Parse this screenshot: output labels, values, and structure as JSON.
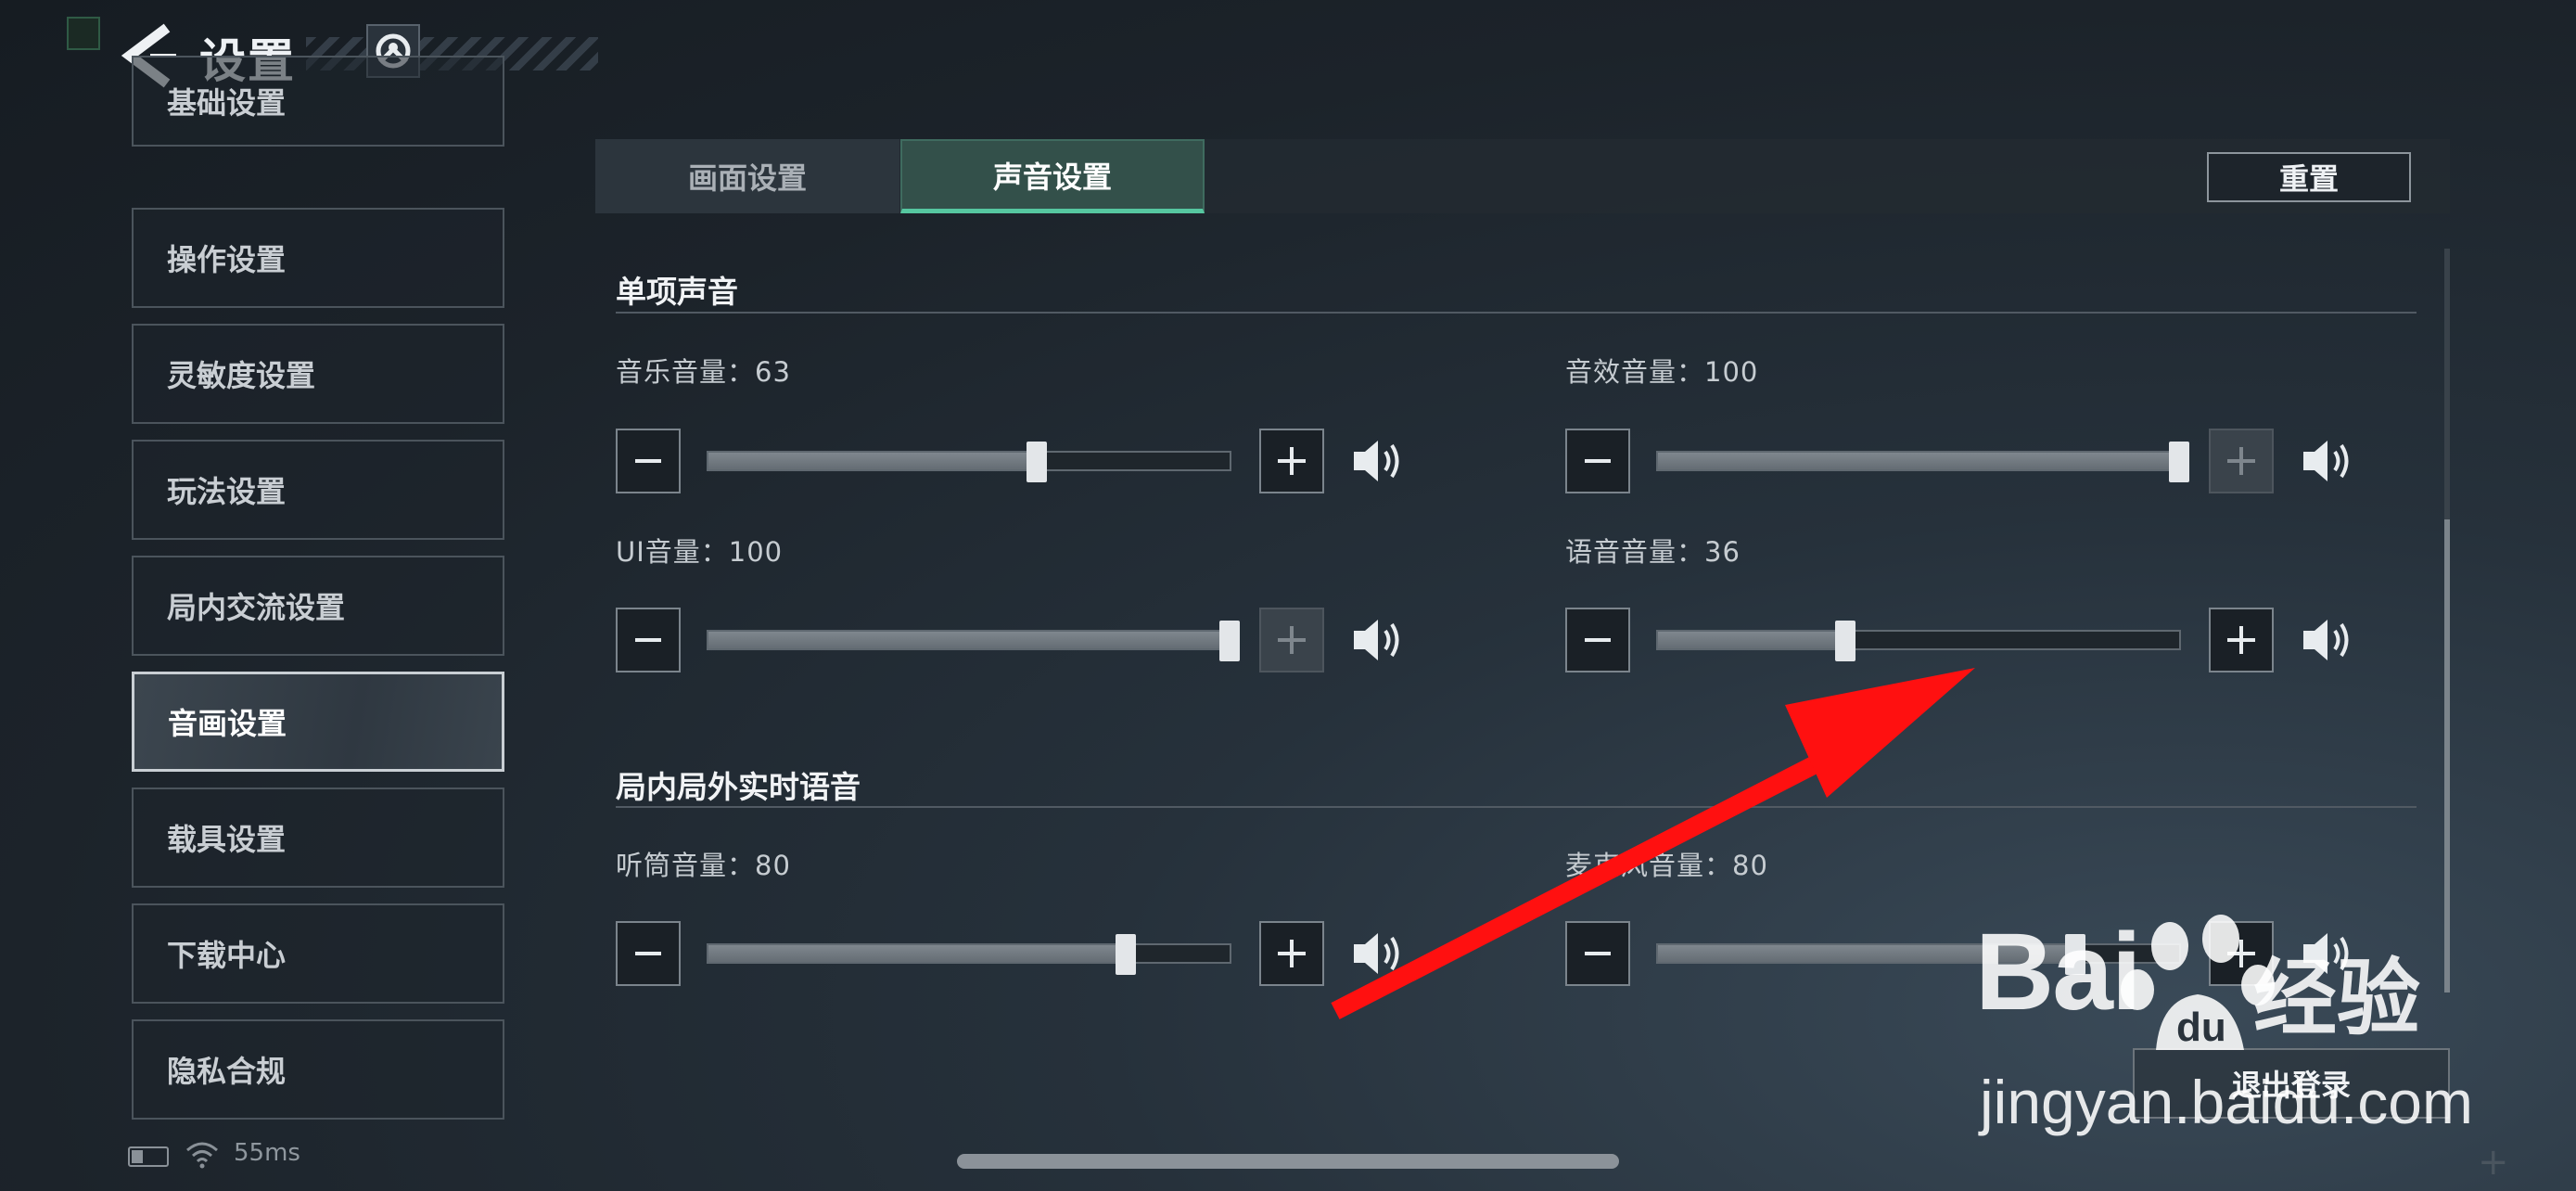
{
  "header": {
    "title": "设置",
    "back_icon": "back-chevron-icon",
    "logo_icon": "game-logo-icon"
  },
  "sidebar": {
    "items": [
      {
        "label": "基础设置",
        "active": false
      },
      {
        "label": "操作设置",
        "active": false
      },
      {
        "label": "灵敏度设置",
        "active": false
      },
      {
        "label": "玩法设置",
        "active": false
      },
      {
        "label": "局内交流设置",
        "active": false
      },
      {
        "label": "音画设置",
        "active": true
      },
      {
        "label": "载具设置",
        "active": false
      },
      {
        "label": "下载中心",
        "active": false
      },
      {
        "label": "隐私合规",
        "active": false
      }
    ]
  },
  "tabs": [
    {
      "label": "画面设置",
      "active": false
    },
    {
      "label": "声音设置",
      "active": true
    }
  ],
  "reset_label": "重置",
  "sections": [
    {
      "title": "单项声音",
      "sliders": [
        {
          "label": "音乐音量：63",
          "value": 63,
          "plus_disabled": false
        },
        {
          "label": "音效音量：100",
          "value": 100,
          "plus_disabled": true
        },
        {
          "label": "UI音量：100",
          "value": 100,
          "plus_disabled": true
        },
        {
          "label": "语音音量：36",
          "value": 36,
          "plus_disabled": false
        }
      ]
    },
    {
      "title": "局内局外实时语音",
      "sliders": [
        {
          "label": "听筒音量：80",
          "value": 80,
          "plus_disabled": false
        },
        {
          "label": "麦克风音量：80",
          "value": 80,
          "plus_disabled": false
        }
      ]
    }
  ],
  "logout_label": "退出登录",
  "status": {
    "ping": "55ms"
  },
  "watermark": {
    "brand_a": "Bai",
    "brand_b": "du",
    "brand_c": "经验",
    "url": "jingyan.baidu.com"
  },
  "colors": {
    "accent": "#56c7a0",
    "arrow": "#ff1010"
  }
}
